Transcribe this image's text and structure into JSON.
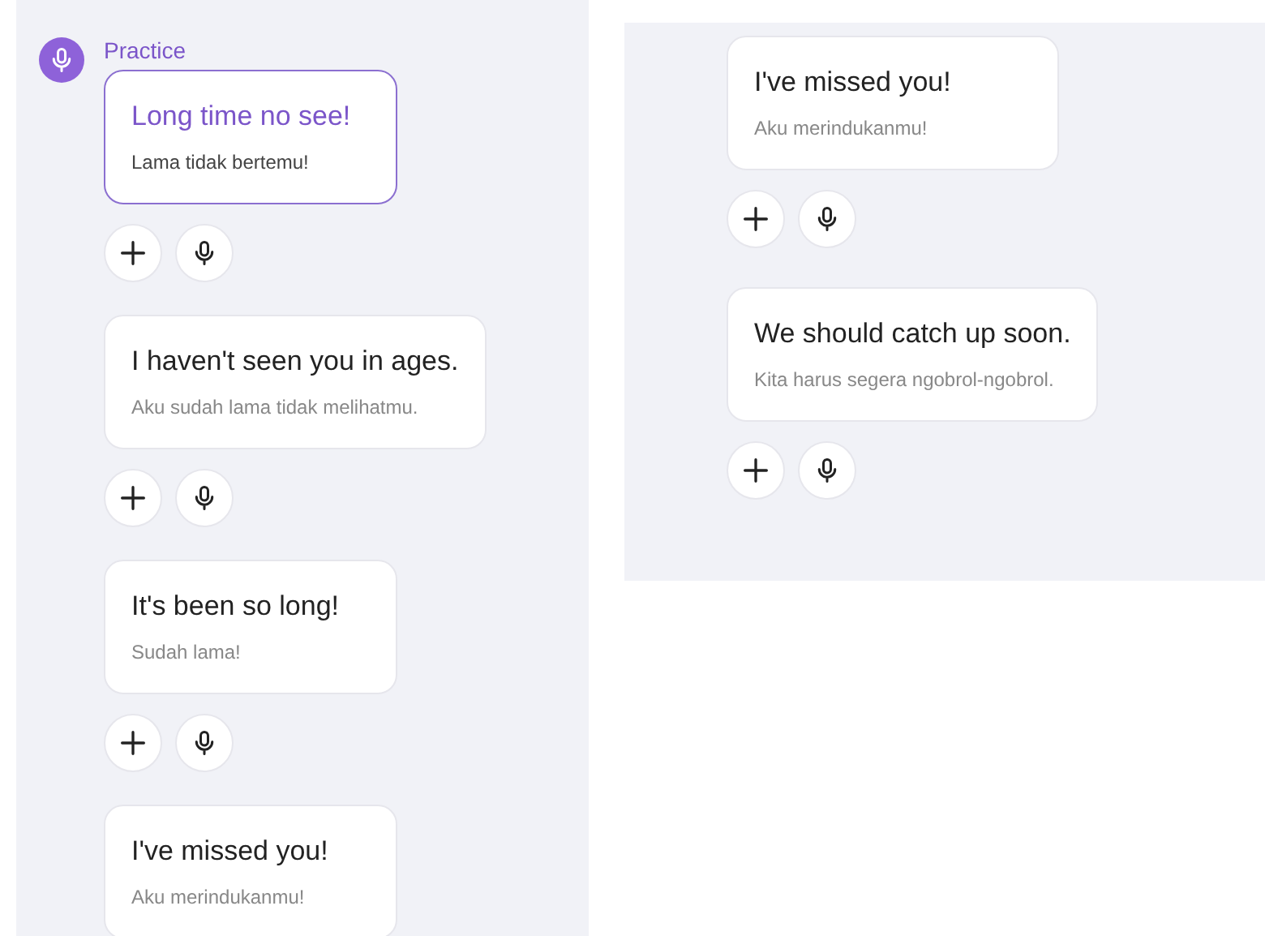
{
  "left_panel": {
    "title": "Practice",
    "phrases": [
      {
        "text": "Long time no see!",
        "translation": "Lama tidak bertemu!",
        "selected": true
      },
      {
        "text": "I haven't seen you in ages.",
        "translation": "Aku sudah lama tidak melihatmu.",
        "selected": false
      },
      {
        "text": "It's been so long!",
        "translation": "Sudah lama!",
        "selected": false
      },
      {
        "text": "I've missed you!",
        "translation": "Aku merindukanmu!",
        "selected": false
      }
    ]
  },
  "right_panel": {
    "phrases": [
      {
        "text": "I've missed you!",
        "translation": "Aku merindukanmu!",
        "selected": false
      },
      {
        "text": "We should catch up soon.",
        "translation": "Kita harus segera ngobrol-ngobrol.",
        "selected": false
      }
    ]
  }
}
